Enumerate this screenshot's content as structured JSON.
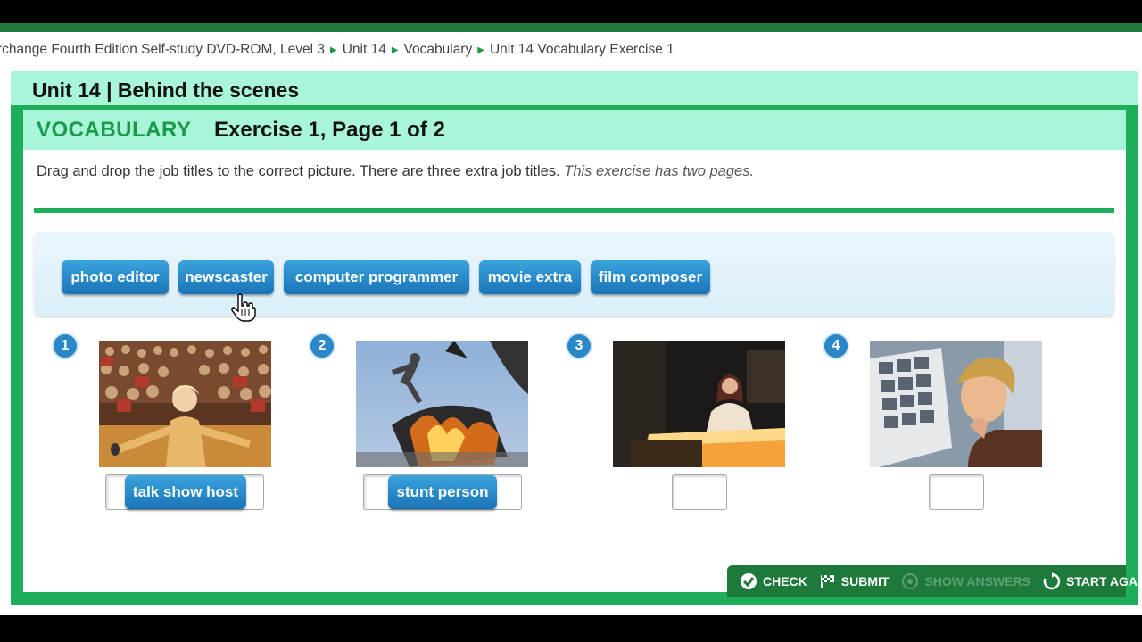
{
  "breadcrumb": [
    "rchange Fourth Edition Self-study DVD-ROM, Level 3",
    "Unit 14",
    "Vocabulary",
    "Unit 14 Vocabulary Exercise 1"
  ],
  "unit_title": "Unit 14 | Behind the scenes",
  "exercise": {
    "section": "VOCABULARY",
    "title": "Exercise 1, Page 1 of 2",
    "instruction": "Drag and drop the job titles to the correct picture. There are three extra job titles.",
    "instruction_note": "This exercise has two pages."
  },
  "word_bank": [
    "photo editor",
    "newscaster",
    "computer programmer",
    "movie extra",
    "film composer"
  ],
  "items": [
    {
      "number": "1",
      "picture": "talk show host on stage with audience",
      "answer": "talk show host"
    },
    {
      "number": "2",
      "picture": "stunt person jumping from exploding car",
      "answer": "stunt person"
    },
    {
      "number": "3",
      "picture": "newscaster at news desk",
      "answer": ""
    },
    {
      "number": "4",
      "picture": "man examining photo contact sheet",
      "answer": ""
    }
  ],
  "toolbar": {
    "check": "CHECK",
    "submit": "SUBMIT",
    "show_answers": "SHOW ANSWERS",
    "start_again": "START AGAIN"
  },
  "colors": {
    "accent_green": "#1eae5a",
    "header_mint": "#a8f5d8",
    "chip_blue": "#1a74b8",
    "toolbar_green": "#1e7a3a"
  }
}
